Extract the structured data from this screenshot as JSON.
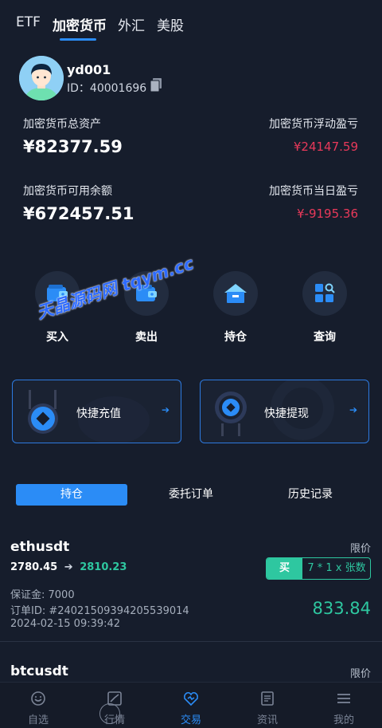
{
  "tabs": [
    {
      "label": "ETF",
      "active": false
    },
    {
      "label": "加密货币",
      "active": true
    },
    {
      "label": "外汇",
      "active": false
    },
    {
      "label": "美股",
      "active": false
    }
  ],
  "profile": {
    "username": "yd001",
    "id_text": "ID：40001696"
  },
  "stats": {
    "total_assets_label": "加密货币总资产",
    "total_assets_value": "¥82377.59",
    "floating_pl_label": "加密货币浮动盈亏",
    "floating_pl_value": "¥24147.59",
    "available_label": "加密货币可用余额",
    "available_value": "¥672457.51",
    "daily_pl_label": "加密货币当日盈亏",
    "daily_pl_value": "¥-9195.36"
  },
  "actions": [
    {
      "label": "买入",
      "icon": "wallet-icon"
    },
    {
      "label": "卖出",
      "icon": "wallet-icon"
    },
    {
      "label": "持仓",
      "icon": "house-icon"
    },
    {
      "label": "查询",
      "icon": "grid-search-icon"
    }
  ],
  "watermark": "天晶源码网 tqym.cc",
  "quick": {
    "deposit": "快捷充值",
    "withdraw": "快捷提现"
  },
  "segments": [
    {
      "label": "持仓",
      "active": true
    },
    {
      "label": "委托订单",
      "active": false
    },
    {
      "label": "历史记录",
      "active": false
    }
  ],
  "positions": [
    {
      "symbol": "ethusdt",
      "order_type": "限价",
      "open_price": "2780.45",
      "arrow": "➔",
      "current_price": "2810.23",
      "side": "买",
      "size": "7 * 1 x 张数",
      "margin": "保证金: 7000",
      "order_id": "订单ID: #24021509394205539014",
      "time": "2024-02-15 09:39:42",
      "pnl": "833.84"
    },
    {
      "symbol": "btcusdt",
      "order_type": "限价"
    }
  ],
  "bottom_nav": [
    {
      "label": "自选",
      "icon": "smile-icon"
    },
    {
      "label": "行情",
      "icon": "chart-icon"
    },
    {
      "label": "交易",
      "icon": "trade-icon"
    },
    {
      "label": "资讯",
      "icon": "news-icon"
    },
    {
      "label": "我的",
      "icon": "menu-icon"
    }
  ],
  "colors": {
    "accent": "#2b8cf6",
    "loss": "#e8395a",
    "gain": "#2ec7a0",
    "background": "#161d2c"
  }
}
